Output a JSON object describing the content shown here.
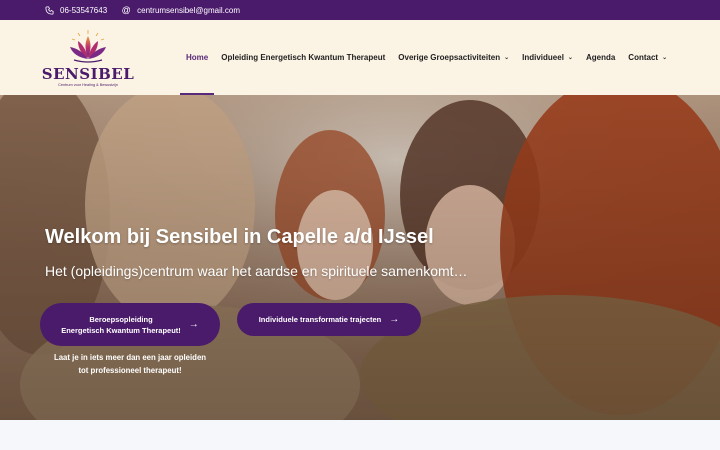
{
  "topbar": {
    "phone_icon": "phone-icon",
    "phone": "06-53547643",
    "email_icon": "at-icon",
    "email_symbol": "@",
    "email": "centrumsensibel@gmail.com"
  },
  "logo": {
    "icon": "lotus-icon",
    "name": "SENSIBEL",
    "tagline": "Centrum voor Healing & Bewustzijn"
  },
  "nav": {
    "items": [
      {
        "label": "Home",
        "active": true
      },
      {
        "label": "Opleiding Energetisch Kwantum Therapeut"
      },
      {
        "label": "Overige Groepsactiviteiten",
        "dropdown": true
      },
      {
        "label": "Individueel",
        "dropdown": true
      },
      {
        "label": "Agenda"
      },
      {
        "label": "Contact",
        "dropdown": true
      }
    ]
  },
  "hero": {
    "title": "Welkom bij Sensibel in Capelle a/d IJssel",
    "subtitle": "Het (opleidings)centrum waar het aardse en spirituele samenkomt…",
    "button1_line1": "Beroepsopleiding",
    "button1_line2": "Energetisch Kwantum Therapeut!",
    "button2": "Individuele transformatie trajecten",
    "arrow_icon": "arrow-right-icon",
    "note_line1": "Laat je in iets meer dan een jaar opleiden",
    "note_line2": "tot professioneel therapeut!"
  },
  "colors": {
    "brand_purple": "#4a1a6b",
    "header_bg": "#fbf3e4",
    "topbar_bg": "#4a1a6b"
  }
}
